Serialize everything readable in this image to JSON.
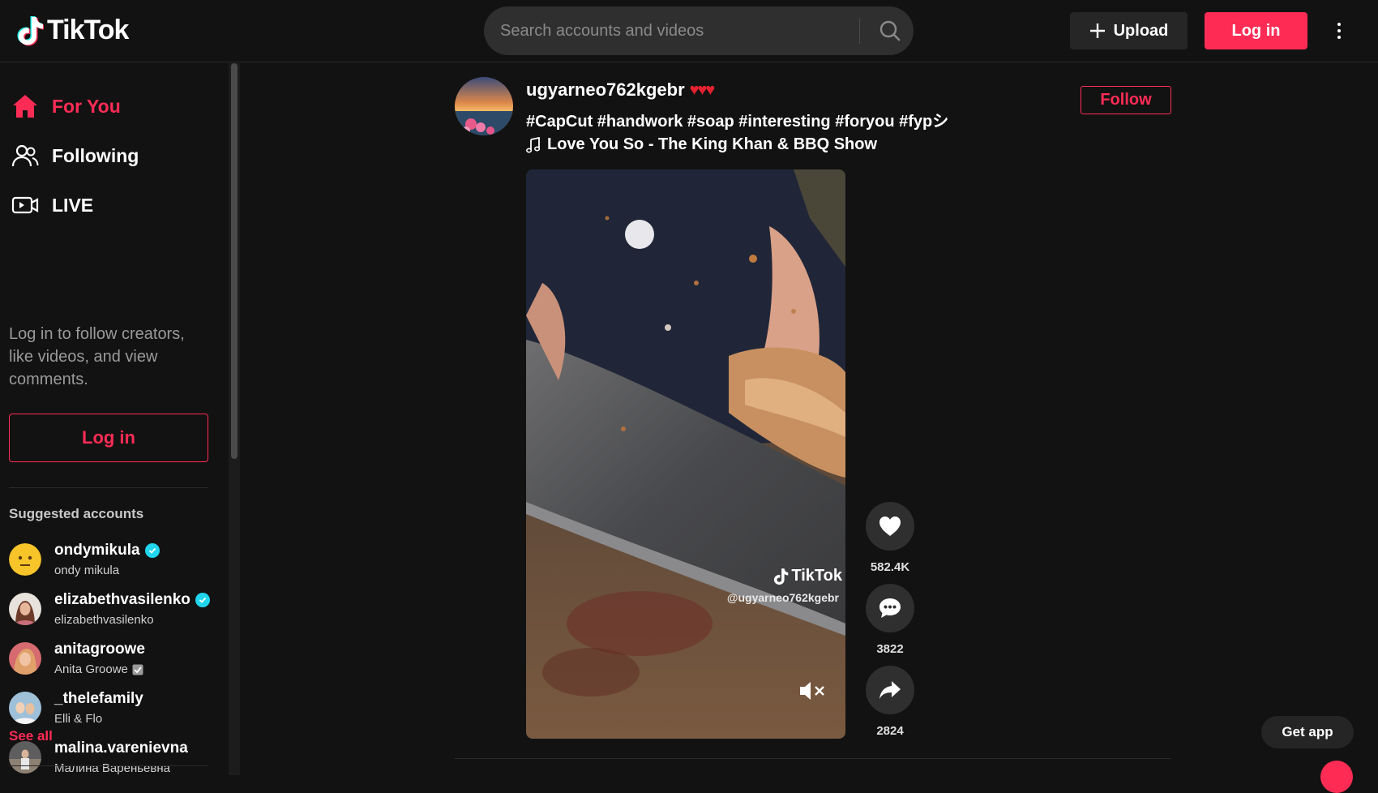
{
  "app": {
    "name": "TikTok"
  },
  "search": {
    "placeholder": "Search accounts and videos"
  },
  "header": {
    "upload_label": "Upload",
    "login_label": "Log in"
  },
  "sidebar": {
    "nav": [
      {
        "label": "For You",
        "icon": "home-icon",
        "active": true
      },
      {
        "label": "Following",
        "icon": "following-icon",
        "active": false
      },
      {
        "label": "LIVE",
        "icon": "live-icon",
        "active": false
      }
    ],
    "login_prompt": "Log in to follow creators, like videos, and view comments.",
    "login_label": "Log in",
    "suggested_title": "Suggested accounts",
    "accounts": [
      {
        "username": "ondymikula",
        "display_name": "ondy mikula",
        "verified": true,
        "display_checked": false
      },
      {
        "username": "elizabethvasilenko",
        "display_name": "elizabethvasilenko",
        "verified": true,
        "display_checked": false
      },
      {
        "username": "anitagroowe",
        "display_name": "Anita Groowe",
        "verified": false,
        "display_checked": true
      },
      {
        "username": "_thelefamily",
        "display_name": "Elli & Flo",
        "verified": false,
        "display_checked": false
      },
      {
        "username": "malina.varenievna",
        "display_name": "Малина Вареньевна",
        "verified": false,
        "display_checked": false
      }
    ],
    "see_all": "See all"
  },
  "post": {
    "username": "ugyarneo762kgebr",
    "hearts": "♥♥♥",
    "caption": "#CapCut #handwork #soap #interesting #foryou #fypシ",
    "music": "Love You So - The King Khan & BBQ Show",
    "follow_label": "Follow",
    "watermark_brand": "TikTok",
    "watermark_handle": "@ugyarneo762kgebr",
    "likes": "582.4K",
    "comments": "3822",
    "shares": "2824"
  },
  "footer": {
    "get_app": "Get app"
  },
  "colors": {
    "accent": "#fe2c55",
    "background": "#121212",
    "verified": "#20d5ec"
  }
}
